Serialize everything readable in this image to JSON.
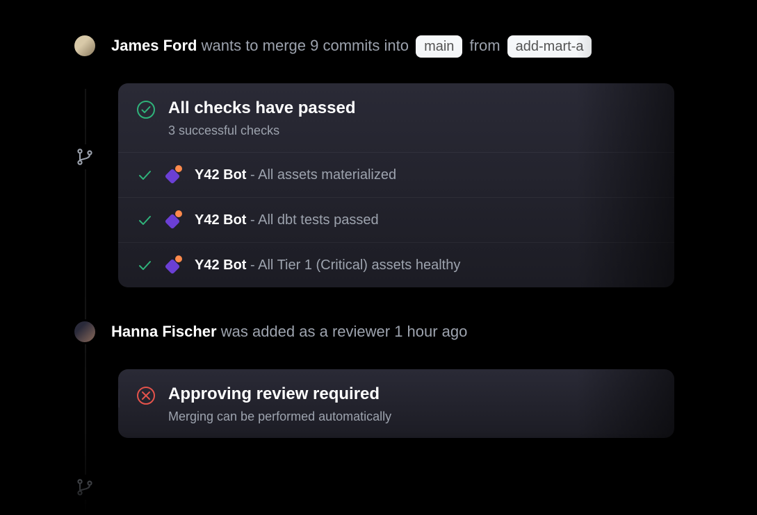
{
  "events": {
    "e1": {
      "author": "James Ford",
      "action_prefix": " wants to merge 9 commits into ",
      "target_branch": "main",
      "from_word": " from ",
      "source_branch": "add-mart-a"
    },
    "e2": {
      "author": "Hanna Fischer",
      "action": " was added as a reviewer 1 hour ago"
    }
  },
  "checks_card": {
    "title": "All checks have passed",
    "subtitle": "3 successful checks",
    "items": [
      {
        "bot": "Y42 Bot",
        "sep": " - ",
        "desc": "All assets materialized"
      },
      {
        "bot": "Y42 Bot",
        "sep": " - ",
        "desc": "All dbt tests passed"
      },
      {
        "bot": "Y42 Bot",
        "sep": " - ",
        "desc": "All Tier 1 (Critical) assets healthy"
      }
    ]
  },
  "review_card": {
    "title": "Approving review required",
    "subtitle": "Merging can be performed automatically"
  }
}
